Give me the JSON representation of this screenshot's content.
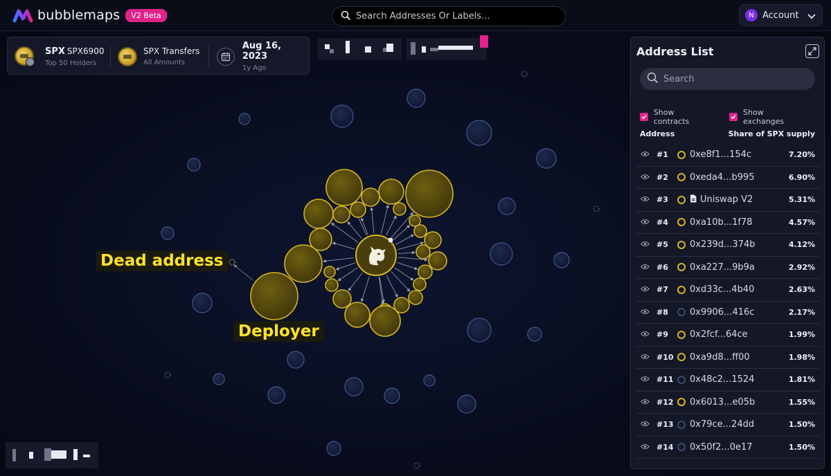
{
  "app": {
    "name": "bubblemaps",
    "badge": "V2 Beta"
  },
  "search": {
    "placeholder": "Search Addresses Or Labels..."
  },
  "account": {
    "avatar_letter": "N",
    "label": "Account"
  },
  "token_info": {
    "symbol": "SPX",
    "full_name": "SPX6900",
    "holders_label": "Top 50 Holders",
    "transfers_title": "SPX Transfers",
    "transfers_sub": "All Amounts",
    "date": "Aug 16, 2023",
    "date_ago": "1y Ago"
  },
  "graph": {
    "labels": {
      "dead_address": "Dead address",
      "deployer": "Deployer"
    }
  },
  "address_list": {
    "title": "Address List",
    "search_placeholder": "Search",
    "show_contracts": "Show contracts",
    "show_exchanges": "Show exchanges",
    "col_address": "Address",
    "col_share": "Share of SPX supply",
    "rows": [
      {
        "rank": "#1",
        "address": "0xe8f1...154c",
        "share": "7.20%",
        "dot": "gold"
      },
      {
        "rank": "#2",
        "address": "0xeda4...b995",
        "share": "6.90%",
        "dot": "gold"
      },
      {
        "rank": "#3",
        "address": "Uniswap V2",
        "share": "5.31%",
        "dot": "gold",
        "contract": true
      },
      {
        "rank": "#4",
        "address": "0xa10b...1f78",
        "share": "4.57%",
        "dot": "gold"
      },
      {
        "rank": "#5",
        "address": "0x239d...374b",
        "share": "4.12%",
        "dot": "gold"
      },
      {
        "rank": "#6",
        "address": "0xa227...9b9a",
        "share": "2.92%",
        "dot": "gold"
      },
      {
        "rank": "#7",
        "address": "0xd33c...4b40",
        "share": "2.63%",
        "dot": "gold"
      },
      {
        "rank": "#8",
        "address": "0x9906...416c",
        "share": "2.17%",
        "dot": "blue"
      },
      {
        "rank": "#9",
        "address": "0x2fcf...64ce",
        "share": "1.99%",
        "dot": "gold"
      },
      {
        "rank": "#10",
        "address": "0xa9d8...ff00",
        "share": "1.98%",
        "dot": "gold"
      },
      {
        "rank": "#11",
        "address": "0x48c2...1524",
        "share": "1.81%",
        "dot": "blue"
      },
      {
        "rank": "#12",
        "address": "0x6013...e05b",
        "share": "1.55%",
        "dot": "gold"
      },
      {
        "rank": "#13",
        "address": "0x79ce...24dd",
        "share": "1.50%",
        "dot": "blue"
      },
      {
        "rank": "#14",
        "address": "0x50f2...0e17",
        "share": "1.50%",
        "dot": "blue"
      }
    ]
  },
  "colors": {
    "accent_pink": "#e0228a",
    "bubble_gold": "#d9b81e",
    "bubble_blue": "#2a3a66"
  },
  "icons": {
    "logo": "bubblemaps-logo-icon",
    "search": "search-icon",
    "chevron": "chevron-down-icon",
    "calendar": "calendar-icon",
    "expand": "expand-icon",
    "eye": "eye-icon",
    "contract": "document-icon"
  }
}
